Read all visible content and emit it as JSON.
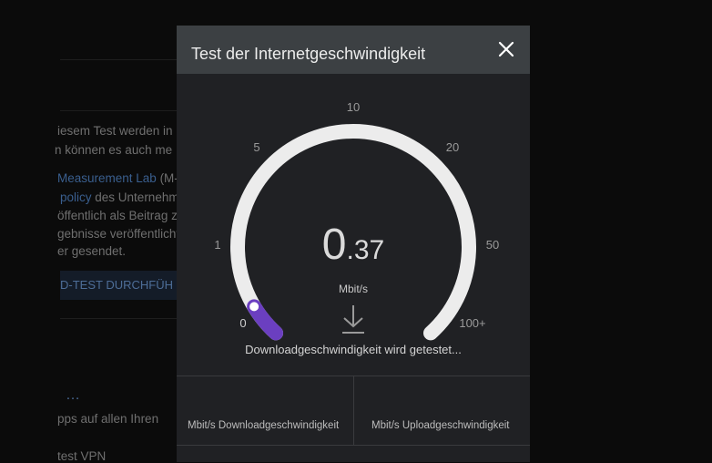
{
  "background": {
    "snippets": [
      "iesem Test werden in",
      "n können es auch me",
      "des Unternehm",
      "öffentlich als Beitrag z",
      "gebnisse veröffentlicht",
      "er gesendet.",
      "pps auf allen Ihren",
      "test VPN"
    ],
    "link_mlab": "Measurement Lab",
    "link_mlab_suffix": " (M-",
    "link_policy": "policy",
    "button_label": "D-TEST DURCHFÜH",
    "more_dots": "…"
  },
  "dialog": {
    "title": "Test der Internetgeschwindigkeit",
    "close_icon": "close-icon",
    "speed_integer": "0",
    "speed_decimal": ".37",
    "speed_unit": "Mbit/s",
    "current_speed_mbps": 0.37,
    "scale_labels": [
      "0",
      "1",
      "5",
      "10",
      "20",
      "50",
      "100+"
    ],
    "status_text": "Downloadgeschwindigkeit wird getestet...",
    "download_label": "Mbit/s Downloadgeschwindigkeit",
    "upload_label": "Mbit/s Uploadgeschwindigkeit",
    "colors": {
      "progress": "#6b3fc0",
      "track": "#ececec",
      "header": "#3c4043",
      "panel": "#202124"
    }
  }
}
